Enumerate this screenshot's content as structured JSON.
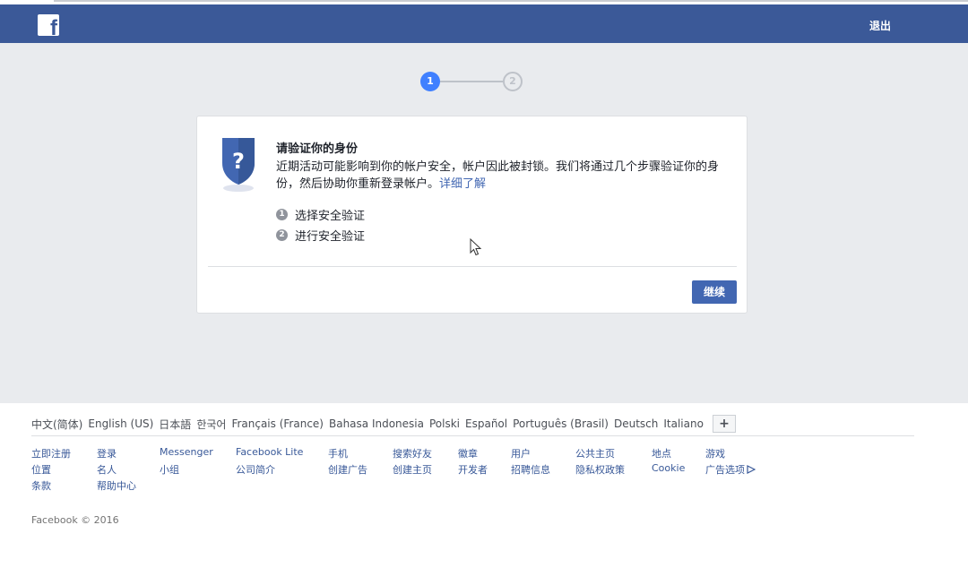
{
  "header": {
    "logo_letter": "f",
    "logout_label": "退出",
    "brand_color": "#3b5998"
  },
  "steps": {
    "current": "1",
    "next": "2"
  },
  "card": {
    "title": "请验证你的身份",
    "description": "近期活动可能影响到你的帐户安全，帐户因此被封锁。我们将通过几个步骤验证你的身份，然后协助你重新登录帐户。",
    "learn_more": "详细了解",
    "step_items": [
      {
        "num": "1",
        "label": "选择安全验证"
      },
      {
        "num": "2",
        "label": "进行安全验证"
      }
    ],
    "continue_label": "继续",
    "shield_icon": "question-shield-icon"
  },
  "footer": {
    "languages": [
      "中文(简体)",
      "English (US)",
      "日本語",
      "한국어",
      "Français (France)",
      "Bahasa Indonesia",
      "Polski",
      "Español",
      "Português (Brasil)",
      "Deutsch",
      "Italiano"
    ],
    "add_language": "+",
    "links": [
      "立即注册",
      "登录",
      "Messenger",
      "Facebook Lite",
      "手机",
      "搜索好友",
      "徽章",
      "用户",
      "公共主页",
      "地点",
      "游戏",
      "位置",
      "名人",
      "小组",
      "公司简介",
      "创建广告",
      "创建主页",
      "开发者",
      "招聘信息",
      "隐私权政策",
      "Cookie",
      "广告选项",
      "条款",
      "帮助中心"
    ],
    "copyright": "Facebook © 2016"
  }
}
